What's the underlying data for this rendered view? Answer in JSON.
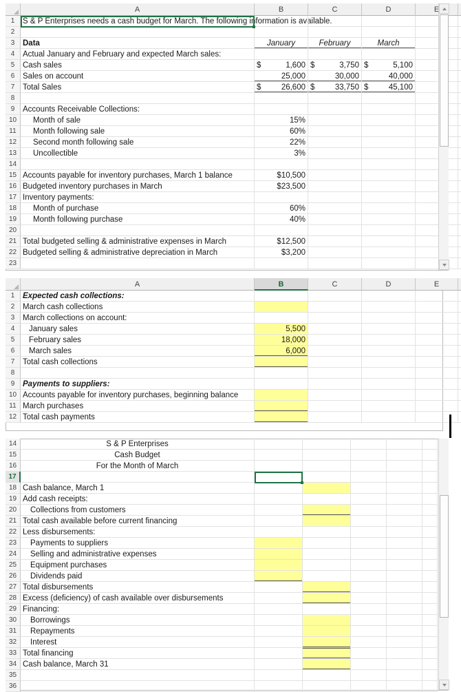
{
  "app": {
    "name": "excel-spreadsheet",
    "accent": "#217346",
    "highlight": "#FFFF99"
  },
  "panel1": {
    "name": "data-assumptions-sheet",
    "columns": [
      "",
      "A",
      "B",
      "C",
      "D",
      "E",
      ""
    ],
    "selected_cell": "A1",
    "rows": [
      {
        "n": "1",
        "A": "S & P Enterprises needs a cash budget for March. The following information is available.",
        "B": "",
        "C": "",
        "D": ""
      },
      {
        "n": "2",
        "A": "",
        "B": "",
        "C": "",
        "D": ""
      },
      {
        "n": "3",
        "A": "Data",
        "B": "January",
        "C": "February",
        "D": "March"
      },
      {
        "n": "4",
        "A": "Actual January and February and expected March sales:",
        "B": "",
        "C": "",
        "D": ""
      },
      {
        "n": "5",
        "A": "Cash sales",
        "B": "1,600",
        "C": "3,750",
        "D": "5,100",
        "sym": "$"
      },
      {
        "n": "6",
        "A": "Sales on account",
        "B": "25,000",
        "C": "30,000",
        "D": "40,000"
      },
      {
        "n": "7",
        "A": "Total Sales",
        "B": "26,600",
        "C": "33,750",
        "D": "45,100",
        "sym": "$"
      },
      {
        "n": "8",
        "A": "",
        "B": "",
        "C": "",
        "D": ""
      },
      {
        "n": "9",
        "A": "Accounts Receivable Collections:",
        "B": "",
        "C": "",
        "D": ""
      },
      {
        "n": "10",
        "A": "Month of sale",
        "B": "15%",
        "C": "",
        "D": ""
      },
      {
        "n": "11",
        "A": "Month following sale",
        "B": "60%",
        "C": "",
        "D": ""
      },
      {
        "n": "12",
        "A": "Second month following sale",
        "B": "22%",
        "C": "",
        "D": ""
      },
      {
        "n": "13",
        "A": "Uncollectible",
        "B": "3%",
        "C": "",
        "D": ""
      },
      {
        "n": "14",
        "A": "",
        "B": "",
        "C": "",
        "D": ""
      },
      {
        "n": "15",
        "A": "Accounts payable for inventory purchases, March 1 balance",
        "B": "$10,500",
        "C": "",
        "D": ""
      },
      {
        "n": "16",
        "A": "Budgeted inventory purchases in March",
        "B": "$23,500",
        "C": "",
        "D": ""
      },
      {
        "n": "17",
        "A": "Inventory payments:",
        "B": "",
        "C": "",
        "D": ""
      },
      {
        "n": "18",
        "A": "Month of purchase",
        "B": "60%",
        "C": "",
        "D": ""
      },
      {
        "n": "19",
        "A": "Month following purchase",
        "B": "40%",
        "C": "",
        "D": ""
      },
      {
        "n": "20",
        "A": "",
        "B": "",
        "C": "",
        "D": ""
      },
      {
        "n": "21",
        "A": "Total budgeted selling & administrative expenses in March",
        "B": "$12,500",
        "C": "",
        "D": ""
      },
      {
        "n": "22",
        "A": "Budgeted selling & administrative depreciation in March",
        "B": "$3,200",
        "C": "",
        "D": ""
      },
      {
        "n": "23",
        "A": "",
        "B": "",
        "C": "",
        "D": ""
      }
    ]
  },
  "panel2": {
    "name": "schedules-sheet",
    "columns": [
      "",
      "A",
      "B",
      "C",
      "D",
      "E",
      ""
    ],
    "selected_column": "B",
    "rows": [
      {
        "n": "1",
        "A": "Expected cash collections:",
        "B": ""
      },
      {
        "n": "2",
        "A": "March cash collections",
        "B": ""
      },
      {
        "n": "3",
        "A": "March collections on account:",
        "B": ""
      },
      {
        "n": "4",
        "A": "January sales",
        "B": "5,500"
      },
      {
        "n": "5",
        "A": "February sales",
        "B": "18,000"
      },
      {
        "n": "6",
        "A": "March sales",
        "B": "6,000"
      },
      {
        "n": "7",
        "A": "Total cash collections",
        "B": ""
      },
      {
        "n": "8",
        "A": "",
        "B": ""
      },
      {
        "n": "9",
        "A": "Payments to suppliers:",
        "B": ""
      },
      {
        "n": "10",
        "A": "Accounts payable for inventory purchases, beginning balance",
        "B": ""
      },
      {
        "n": "11",
        "A": "March purchases",
        "B": ""
      },
      {
        "n": "12",
        "A": "Total cash payments",
        "B": ""
      }
    ]
  },
  "panel3": {
    "name": "cash-budget-sheet",
    "selected_cell": "B17",
    "title_lines": [
      "S & P Enterprises",
      "Cash Budget",
      "For the Month of March"
    ],
    "rows": [
      {
        "n": "14",
        "A": "S & P Enterprises"
      },
      {
        "n": "15",
        "A": "Cash Budget"
      },
      {
        "n": "16",
        "A": "For the Month of March"
      },
      {
        "n": "17",
        "A": ""
      },
      {
        "n": "18",
        "A": "Cash balance, March 1"
      },
      {
        "n": "19",
        "A": "Add cash receipts:"
      },
      {
        "n": "20",
        "A": "Collections from customers"
      },
      {
        "n": "21",
        "A": "Total cash available before current financing"
      },
      {
        "n": "22",
        "A": "Less disbursements:"
      },
      {
        "n": "23",
        "A": "Payments to suppliers"
      },
      {
        "n": "24",
        "A": "Selling and administrative expenses"
      },
      {
        "n": "25",
        "A": "Equipment purchases"
      },
      {
        "n": "26",
        "A": "Dividends paid"
      },
      {
        "n": "27",
        "A": "Total disbursements"
      },
      {
        "n": "28",
        "A": "Excess (deficiency) of cash available over disbursements"
      },
      {
        "n": "29",
        "A": "Financing:"
      },
      {
        "n": "30",
        "A": "Borrowings"
      },
      {
        "n": "31",
        "A": "Repayments"
      },
      {
        "n": "32",
        "A": "Interest"
      },
      {
        "n": "33",
        "A": "Total financing"
      },
      {
        "n": "34",
        "A": "Cash balance, March 31"
      },
      {
        "n": "35",
        "A": ""
      },
      {
        "n": "36",
        "A": ""
      }
    ]
  }
}
